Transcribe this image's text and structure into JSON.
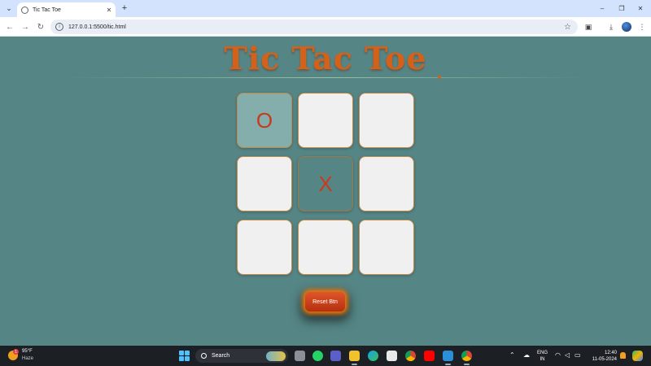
{
  "browser": {
    "tab_title": "Tic Tac Toe",
    "url": "127.0.0.1:5500/tic.html"
  },
  "game": {
    "title": "Tic Tac Toe",
    "board": [
      "O",
      "",
      "",
      "",
      "X",
      "",
      "",
      "",
      ""
    ],
    "reset_label": "Reset Btn",
    "accent_color": "#d4611a",
    "mark_color": "#c83a1e",
    "page_bg": "#558585"
  },
  "taskbar": {
    "weather_temp": "95°F",
    "weather_condition": "Haze",
    "weather_badge": "1",
    "search_label": "Search",
    "lang_line1": "ENG",
    "lang_line2": "IN",
    "time": "12:40",
    "date": "11-05-2024"
  }
}
